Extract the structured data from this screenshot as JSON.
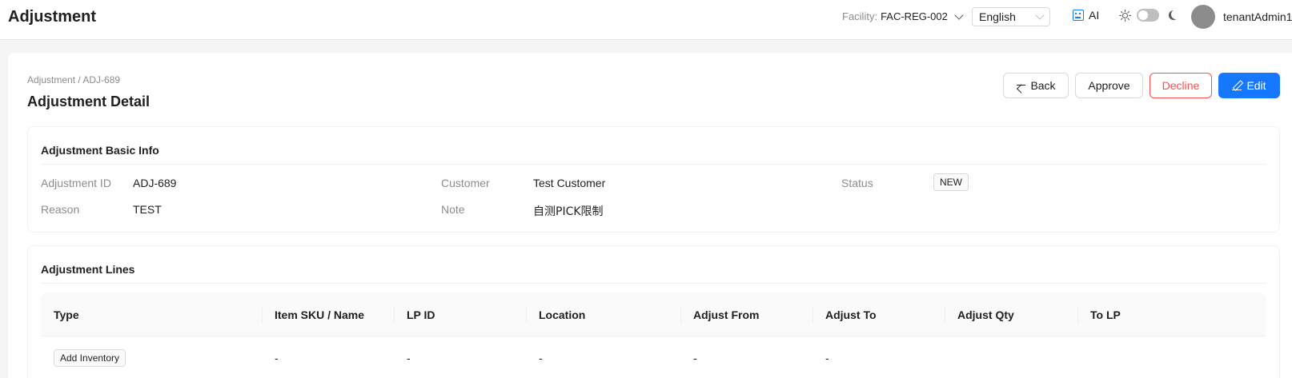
{
  "header": {
    "title": "Adjustment",
    "facility_label": "Facility:",
    "facility_value": "FAC-REG-002",
    "language": "English",
    "ai_label": "AI",
    "username": "tenantAdmin1"
  },
  "page": {
    "breadcrumb": "Adjustment / ADJ-689",
    "title": "Adjustment Detail",
    "buttons": {
      "back": "Back",
      "approve": "Approve",
      "decline": "Decline",
      "edit": "Edit"
    }
  },
  "basic_info": {
    "title": "Adjustment Basic Info",
    "fields": {
      "id_label": "Adjustment ID",
      "id_value": "ADJ-689",
      "customer_label": "Customer",
      "customer_value": "Test Customer",
      "status_label": "Status",
      "status_value": "NEW",
      "reason_label": "Reason",
      "reason_value": "TEST",
      "note_label": "Note",
      "note_value": "自测PICK限制"
    }
  },
  "lines": {
    "title": "Adjustment Lines",
    "columns": [
      "Type",
      "Item SKU / Name",
      "LP ID",
      "Location",
      "Adjust From",
      "Adjust To",
      "Adjust Qty",
      "To LP"
    ],
    "rows": [
      {
        "type": "Add Inventory",
        "item": "-",
        "lp_id": "-",
        "location": "-",
        "adjust_from": "-",
        "adjust_to": "-",
        "adjust_qty": "",
        "to_lp": ""
      }
    ]
  },
  "colors": {
    "primary": "#1677ff",
    "danger": "#ff4d4f",
    "muted": "#8c8c8c"
  }
}
